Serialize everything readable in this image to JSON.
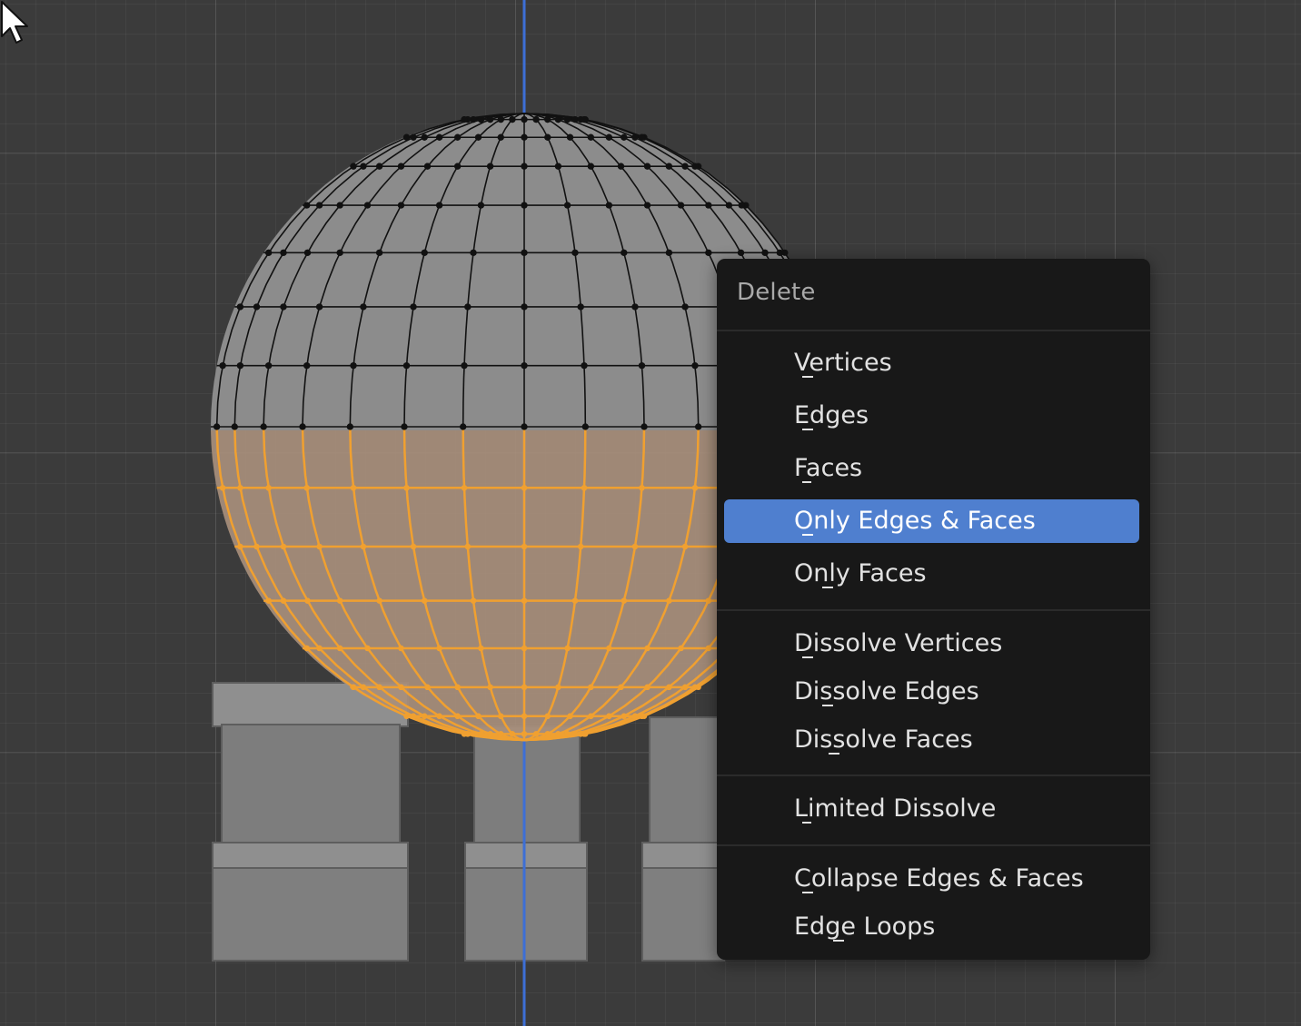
{
  "menu": {
    "title": "Delete",
    "items": [
      {
        "label": "Vertices"
      },
      {
        "label": "Edges"
      },
      {
        "label": "Faces"
      },
      {
        "label": "Only Edges & Faces",
        "highlighted": true
      },
      {
        "label": "Only Faces"
      },
      {
        "label": "Dissolve Vertices"
      },
      {
        "label": "Dissolve Edges"
      },
      {
        "label": "Dissolve Faces"
      },
      {
        "label": "Limited Dissolve"
      },
      {
        "label": "Collapse Edges & Faces"
      },
      {
        "label": "Edge Loops"
      }
    ]
  },
  "colors": {
    "viewport_bg": "#3b3b3b",
    "menu_bg": "#181818",
    "highlight": "#4f7fcf",
    "selection": "#f0a030",
    "z_axis": "#3d6fd6"
  },
  "icons": [
    "mouse-pointer-icon"
  ]
}
